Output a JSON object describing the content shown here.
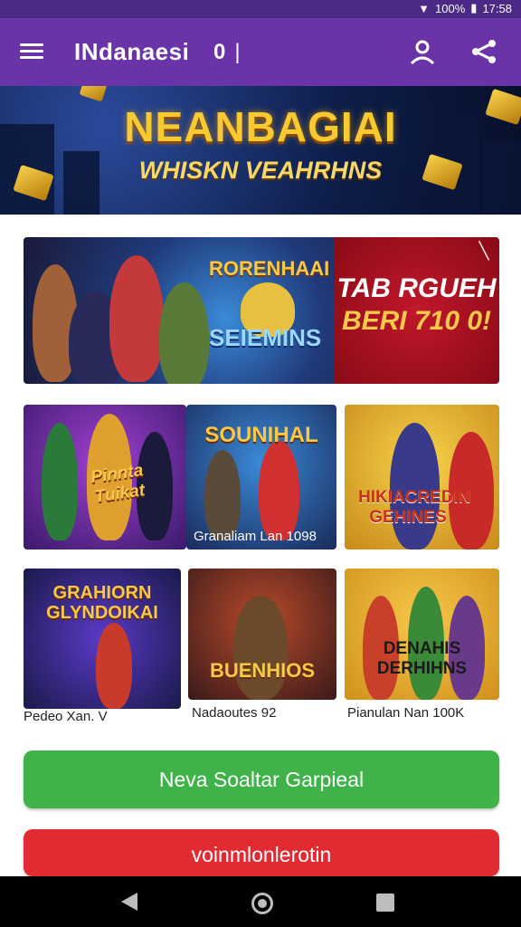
{
  "status_bar": {
    "battery_text": "100%",
    "time": "17:58"
  },
  "app_bar": {
    "title": "INdanaesi",
    "title_glyph": "0",
    "menu_icon": "hamburger-icon",
    "user_icon": "user-icon",
    "share_icon": "share-icon"
  },
  "hero": {
    "title": "NEANBAGIAI",
    "subtitle": "WHISKN VEAHRHNS"
  },
  "feature": {
    "game_title": "RORENHAAI",
    "game_subtitle": "SEIEMINS",
    "promo_line1": "TAB RGUEH",
    "promo_line2": "BERI 710 0!"
  },
  "tiles": [
    {
      "label": "Pinnta Tuikat",
      "caption": ""
    },
    {
      "label": "SOUNIHAL",
      "caption": "Granaliam Lan 1098"
    },
    {
      "label": "HIKIACREDIN GEHINES",
      "caption": ""
    },
    {
      "label": "GRAHIORN GLYNDOIKAI",
      "caption": "Pedeo Xan. V"
    },
    {
      "label": "BUENHIOS",
      "caption": "Nadaoutes 92"
    },
    {
      "label": "DENAHIS DERHIHNS",
      "caption": "Pianulan Nan 100K"
    }
  ],
  "buttons": {
    "primary": "Neva Soaltar Garpieal",
    "secondary": "voinmlonlerotin"
  },
  "colors": {
    "app_bar": "#6a34a8",
    "primary_button": "#3fb34a",
    "secondary_button": "#e22a33"
  }
}
